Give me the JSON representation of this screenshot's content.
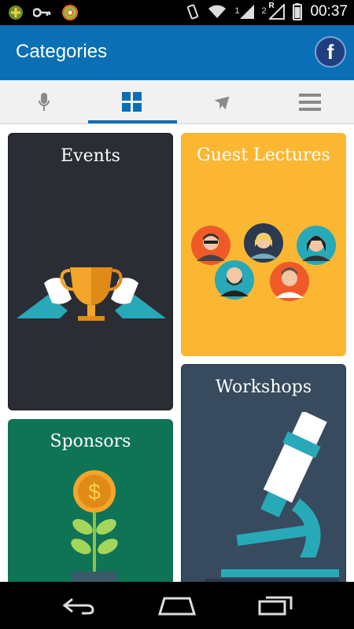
{
  "status_bar": {
    "time": "00:37",
    "icons": [
      "app-notification-icon",
      "key-icon",
      "sync-icon",
      "vibrate-icon",
      "wifi-icon",
      "signal-icon",
      "roaming-signal-icon",
      "battery-icon"
    ],
    "signal_labels": [
      "1",
      "2",
      "R"
    ]
  },
  "app_bar": {
    "title": "Categories",
    "social_label": "f"
  },
  "tabs": [
    {
      "icon": "microphone-icon"
    },
    {
      "icon": "grid-icon",
      "selected": true
    },
    {
      "icon": "airplane-icon"
    },
    {
      "icon": "menu-icon"
    }
  ],
  "cards": {
    "events": {
      "title": "Events",
      "color": "#2b2d35"
    },
    "guest_lectures": {
      "title": "Guest Lectures",
      "color": "#fbb732"
    },
    "sponsors": {
      "title": "Sponsors",
      "color": "#0f7356"
    },
    "workshops": {
      "title": "Workshops",
      "color": "#374a5e"
    }
  },
  "colors": {
    "app_bar": "#0a6fb5",
    "accent": "#0a6fb5"
  },
  "nav_bar": {
    "icons": [
      "back-icon",
      "home-icon",
      "recent-apps-icon"
    ]
  }
}
